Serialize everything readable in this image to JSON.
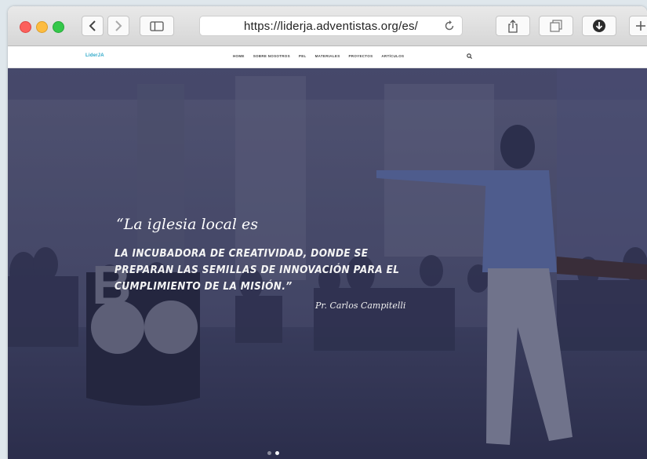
{
  "browser": {
    "url": "https://liderja.adventistas.org/es/",
    "buttons": {
      "back": "chevron-left-icon",
      "forward": "chevron-right-icon",
      "sidebar": "sidebar-icon",
      "share": "share-icon",
      "tabs": "tabs-icon",
      "download": "download-icon",
      "new_tab": "plus-icon"
    }
  },
  "site": {
    "logo": "LiderJA",
    "menu": [
      "HOME",
      "SOBRE NOSOTROS",
      "PEL",
      "MATERIALES",
      "PROYECTOS",
      "ARTÍCULOS"
    ],
    "search_icon": "search-icon"
  },
  "hero": {
    "quote_intro": "“La iglesia local es",
    "quote_body": "la incubadora de creatividad, donde se preparan las semillas de innovación para el cumplimiento de la misión.”",
    "quote_author": "Pr. Carlos Campitelli",
    "slide_count": 2,
    "active_slide": 2
  },
  "colors": {
    "overlay": "#3c3f66",
    "logo": "#2aa7c8"
  }
}
